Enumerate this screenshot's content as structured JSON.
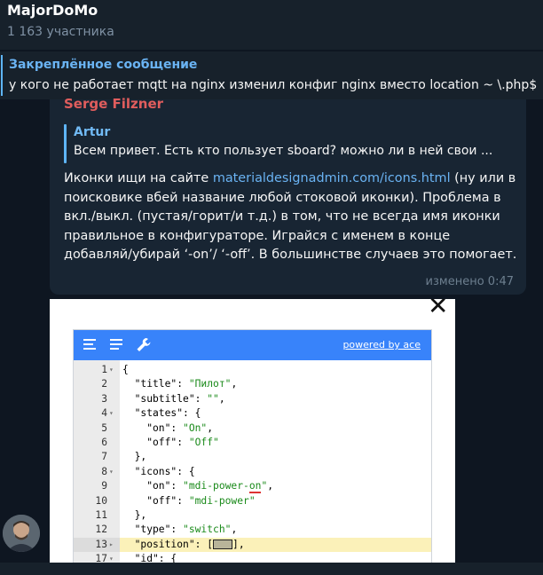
{
  "header": {
    "title": "MajorDoMo",
    "subtitle": "1 163 участника"
  },
  "pinned": {
    "title": "Закреплённое сообщение",
    "text": "у кого не работает mqtt на nginx изменил конфиг nginx   вместо location ~ \\.php$"
  },
  "message": {
    "sender": "Serge Filzner",
    "reply_author": "Artur",
    "reply_text": "Всем привет. Есть кто пользует sboard? можно ли в ней свои ...",
    "text_before_link": "Иконки ищи на сайте ",
    "link": "materialdesignadmin.com/icons.html",
    "text_after_link": " (ну или в поисковике вбей название любой стоковой иконки). Проблема в вкл./выкл. (пустая/горит/и т.д.) в том, что не всегда имя иконки правильное в конфигураторе. Играйся с именем в конце добавляй/убирай ‘-on’/ ‘-off’. В большинстве случаев это помогает.",
    "edited": "изменено 0:47"
  },
  "editor": {
    "powered_by": "powered by ace",
    "lines": [
      {
        "n": "1",
        "fold": "▾",
        "parts": [
          {
            "t": "{",
            "c": "k"
          }
        ]
      },
      {
        "n": "2",
        "fold": "",
        "parts": [
          {
            "t": "  \"title\": ",
            "c": "k"
          },
          {
            "t": "\"Пилот\"",
            "c": "s"
          },
          {
            "t": ",",
            "c": "k"
          }
        ]
      },
      {
        "n": "3",
        "fold": "",
        "parts": [
          {
            "t": "  \"subtitle\": ",
            "c": "k"
          },
          {
            "t": "\"\"",
            "c": "s"
          },
          {
            "t": ",",
            "c": "k"
          }
        ]
      },
      {
        "n": "4",
        "fold": "▾",
        "parts": [
          {
            "t": "  \"states\": {",
            "c": "k"
          }
        ]
      },
      {
        "n": "5",
        "fold": "",
        "parts": [
          {
            "t": "    \"on\": ",
            "c": "k"
          },
          {
            "t": "\"On\"",
            "c": "s"
          },
          {
            "t": ",",
            "c": "k"
          }
        ]
      },
      {
        "n": "6",
        "fold": "",
        "parts": [
          {
            "t": "    \"off\": ",
            "c": "k"
          },
          {
            "t": "\"Off\"",
            "c": "s"
          }
        ]
      },
      {
        "n": "7",
        "fold": "",
        "parts": [
          {
            "t": "  },",
            "c": "k"
          }
        ]
      },
      {
        "n": "8",
        "fold": "▾",
        "parts": [
          {
            "t": "  \"icons\": {",
            "c": "k"
          }
        ]
      },
      {
        "n": "9",
        "fold": "",
        "parts": [
          {
            "t": "    \"on\": ",
            "c": "k"
          },
          {
            "t": "\"mdi-power-",
            "c": "s"
          },
          {
            "t": "on",
            "c": "s squiggle"
          },
          {
            "t": "\"",
            "c": "s"
          },
          {
            "t": ",",
            "c": "k"
          }
        ]
      },
      {
        "n": "10",
        "fold": "",
        "parts": [
          {
            "t": "    \"off\": ",
            "c": "k"
          },
          {
            "t": "\"mdi-power\"",
            "c": "s"
          }
        ]
      },
      {
        "n": "11",
        "fold": "",
        "parts": [
          {
            "t": "  },",
            "c": "k"
          }
        ]
      },
      {
        "n": "12",
        "fold": "",
        "parts": [
          {
            "t": "  \"type\": ",
            "c": "k"
          },
          {
            "t": "\"switch\"",
            "c": "s"
          },
          {
            "t": ",",
            "c": "k"
          }
        ]
      },
      {
        "n": "13",
        "fold": "▸",
        "highlight": true,
        "parts": [
          {
            "t": "  \"position\": [",
            "c": "k"
          },
          {
            "t": "",
            "c": "box"
          },
          {
            "t": "],",
            "c": "k"
          }
        ]
      },
      {
        "n": "17",
        "fold": "▾",
        "parts": [
          {
            "t": "  \"id\": {",
            "c": "k"
          }
        ]
      }
    ]
  },
  "colors": {
    "background": "#0e1621",
    "panel": "#17212b",
    "bubble": "#182533",
    "accent": "#6ab3f3",
    "sender": "#e05d5d",
    "ace_toolbar": "#3883fa"
  },
  "icons": [
    "close-icon",
    "hamburger-icon",
    "format-icon",
    "wrench-icon",
    "avatar"
  ]
}
